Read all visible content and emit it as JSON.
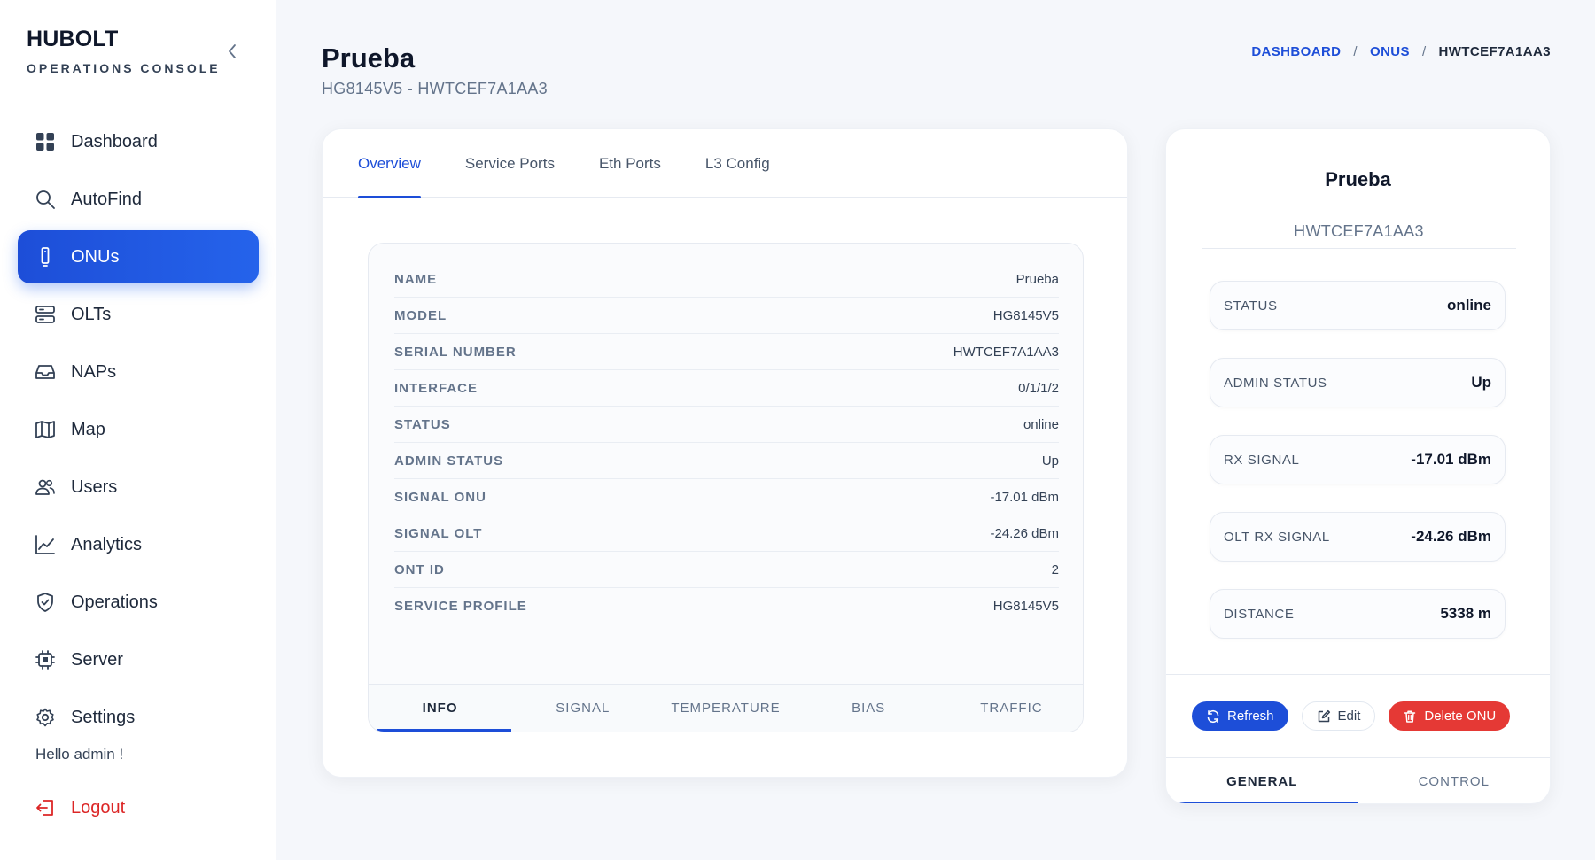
{
  "brand": {
    "title": "HUBOLT",
    "subtitle": "OPERATIONS CONSOLE"
  },
  "sidebar": {
    "items": [
      {
        "label": "Dashboard",
        "icon": "grid-icon",
        "active": false
      },
      {
        "label": "AutoFind",
        "icon": "search-icon",
        "active": false
      },
      {
        "label": "ONUs",
        "icon": "device-icon",
        "active": true
      },
      {
        "label": "OLTs",
        "icon": "server-stack-icon",
        "active": false
      },
      {
        "label": "NAPs",
        "icon": "inbox-icon",
        "active": false
      },
      {
        "label": "Map",
        "icon": "map-icon",
        "active": false
      },
      {
        "label": "Users",
        "icon": "users-icon",
        "active": false
      },
      {
        "label": "Analytics",
        "icon": "chart-line-icon",
        "active": false
      },
      {
        "label": "Operations",
        "icon": "shield-icon",
        "active": false
      },
      {
        "label": "Server",
        "icon": "chip-icon",
        "active": false
      },
      {
        "label": "Settings",
        "icon": "gear-icon",
        "active": false
      }
    ],
    "greeting": "Hello admin !",
    "logout_label": "Logout"
  },
  "header": {
    "title": "Prueba",
    "subtitle": "HG8145V5 - HWTCEF7A1AA3",
    "breadcrumb": [
      "DASHBOARD",
      "ONUS",
      "HWTCEF7A1AA3"
    ]
  },
  "main": {
    "tabs": [
      "Overview",
      "Service Ports",
      "Eth Ports",
      "L3 Config"
    ],
    "active_tab": "Overview",
    "info": [
      {
        "label": "NAME",
        "value": "Prueba"
      },
      {
        "label": "MODEL",
        "value": "HG8145V5"
      },
      {
        "label": "SERIAL NUMBER",
        "value": "HWTCEF7A1AA3"
      },
      {
        "label": "INTERFACE",
        "value": "0/1/1/2"
      },
      {
        "label": "STATUS",
        "value": "online"
      },
      {
        "label": "ADMIN STATUS",
        "value": "Up"
      },
      {
        "label": "SIGNAL ONU",
        "value": "-17.01 dBm"
      },
      {
        "label": "SIGNAL OLT",
        "value": "-24.26 dBm"
      },
      {
        "label": "ONT ID",
        "value": "2"
      },
      {
        "label": "SERVICE PROFILE",
        "value": "HG8145V5"
      }
    ],
    "subtabs": [
      "INFO",
      "SIGNAL",
      "TEMPERATURE",
      "BIAS",
      "TRAFFIC"
    ],
    "active_subtab": "INFO"
  },
  "side": {
    "name": "Prueba",
    "serial": "HWTCEF7A1AA3",
    "stats": [
      {
        "label": "STATUS",
        "value": "online"
      },
      {
        "label": "ADMIN STATUS",
        "value": "Up"
      },
      {
        "label": "RX SIGNAL",
        "value": "-17.01 dBm"
      },
      {
        "label": "OLT RX SIGNAL",
        "value": "-24.26 dBm"
      },
      {
        "label": "DISTANCE",
        "value": "5338 m"
      }
    ],
    "actions": {
      "refresh": "Refresh",
      "edit": "Edit",
      "delete": "Delete ONU"
    },
    "bottom_tabs": [
      "GENERAL",
      "CONTROL"
    ],
    "active_bottom_tab": "GENERAL"
  },
  "colors": {
    "accent": "#1d4ed8",
    "danger": "#e53935",
    "logout": "#dc2626"
  }
}
